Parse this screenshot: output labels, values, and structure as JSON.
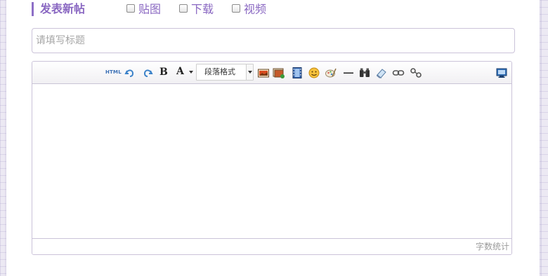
{
  "header": {
    "title": "发表新帖",
    "options": [
      {
        "label": "贴图",
        "checked": false
      },
      {
        "label": "下载",
        "checked": false
      },
      {
        "label": "视频",
        "checked": false
      }
    ]
  },
  "title_input": {
    "placeholder": "请填写标题",
    "value": ""
  },
  "editor": {
    "toolbar": {
      "html_label": "HTML",
      "bold_label": "B",
      "font_label": "A",
      "paragraph_format": "段落格式",
      "icons": [
        "html-source-icon",
        "undo-icon",
        "redo-icon",
        "bold-icon",
        "font-color-icon",
        "paragraph-format-select",
        "insert-image-icon",
        "image-gallery-icon",
        "insert-video-icon",
        "emotion-icon",
        "scrawl-icon",
        "horizontal-rule-icon",
        "search-replace-icon",
        "eraser-icon",
        "link-icon",
        "unlink-icon",
        "fullscreen-icon"
      ]
    },
    "status": {
      "word_count_label": "字数统计"
    }
  },
  "colors": {
    "accent": "#8a68c2",
    "border": "#cbc3d9",
    "background_grid": "#ece9f3"
  }
}
